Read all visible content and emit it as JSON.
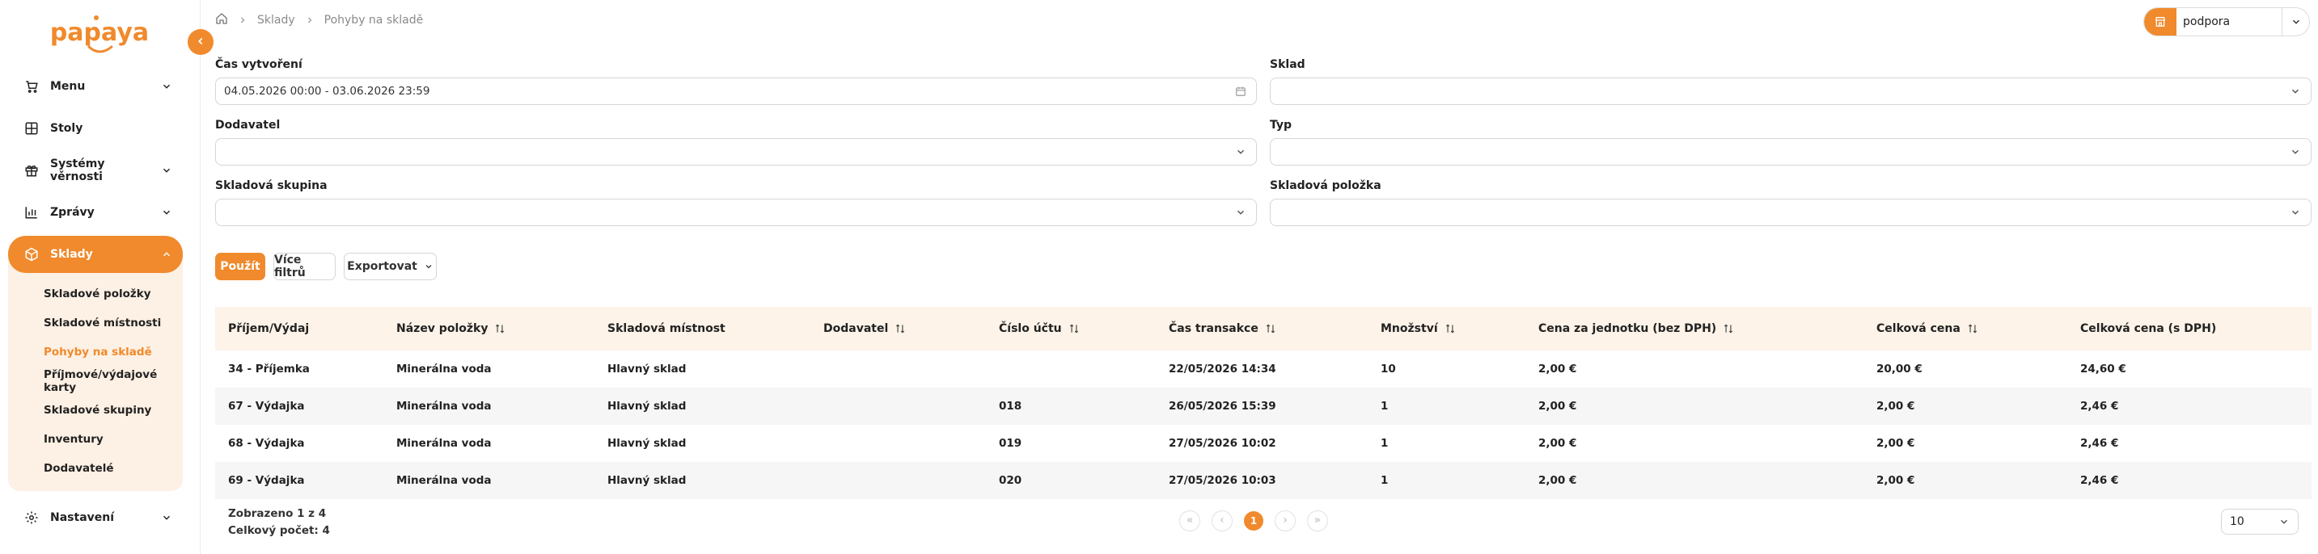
{
  "brand": {
    "logo_text": "papaya",
    "accent": "#f08a2c"
  },
  "sidebar": {
    "items": [
      {
        "label": "Menu",
        "icon": "cart-icon",
        "expandable": true
      },
      {
        "label": "Stoly",
        "icon": "table-grid-icon",
        "expandable": false
      },
      {
        "label": "Systémy věrnosti",
        "icon": "gift-icon",
        "expandable": true
      },
      {
        "label": "Zprávy",
        "icon": "bar-chart-icon",
        "expandable": true
      },
      {
        "label": "Sklady",
        "icon": "box-icon",
        "expandable": true,
        "active": true
      },
      {
        "label": "Nastavení",
        "icon": "gear-icon",
        "expandable": true
      }
    ],
    "sklady_sub": [
      {
        "label": "Skladové položky"
      },
      {
        "label": "Skladové místnosti"
      },
      {
        "label": "Pohyby na skladě",
        "active": true
      },
      {
        "label": "Příjmové/výdajové karty"
      },
      {
        "label": "Skladové skupiny"
      },
      {
        "label": "Inventury"
      },
      {
        "label": "Dodavatelé"
      }
    ]
  },
  "breadcrumb": {
    "home_icon": "home-icon",
    "items": [
      "Sklady",
      "Pohyby na skladě"
    ]
  },
  "account": {
    "name": "podpora",
    "icon": "store-icon"
  },
  "filters": {
    "created_label": "Čas vytvoření",
    "created_value": "04.05.2026 00:00 - 03.06.2026 23:59",
    "warehouse_label": "Sklad",
    "warehouse_value": "",
    "supplier_label": "Dodavatel",
    "supplier_value": "",
    "type_label": "Typ",
    "type_value": "",
    "group_label": "Skladová skupina",
    "group_value": "",
    "item_label": "Skladová položka",
    "item_value": ""
  },
  "actions": {
    "apply": "Použít",
    "more_filters": "Více filtrů",
    "export": "Exportovat"
  },
  "table": {
    "headers": [
      "Příjem/Výdaj",
      "Název položky",
      "Skladová místnost",
      "Dodavatel",
      "Číslo účtu",
      "Čas transakce",
      "Množství",
      "Cena za jednotku (bez DPH)",
      "Celková cena",
      "Celková cena (s DPH)"
    ],
    "sortable": [
      false,
      true,
      false,
      true,
      true,
      true,
      true,
      true,
      true,
      false
    ],
    "rows": [
      [
        "34 - Příjemka",
        "Minerálna voda",
        "Hlavný sklad",
        "",
        "",
        "22/05/2026 14:34",
        "10",
        "2,00 €",
        "20,00 €",
        "24,60 €"
      ],
      [
        "67 - Výdajka",
        "Minerálna voda",
        "Hlavný sklad",
        "",
        "018",
        "26/05/2026 15:39",
        "1",
        "2,00 €",
        "2,00 €",
        "2,46 €"
      ],
      [
        "68 - Výdajka",
        "Minerálna voda",
        "Hlavný sklad",
        "",
        "019",
        "27/05/2026 10:02",
        "1",
        "2,00 €",
        "2,00 €",
        "2,46 €"
      ],
      [
        "69 - Výdajka",
        "Minerálna voda",
        "Hlavný sklad",
        "",
        "020",
        "27/05/2026 10:03",
        "1",
        "2,00 €",
        "2,00 €",
        "2,46 €"
      ]
    ]
  },
  "footer": {
    "shown": "Zobrazeno 1 z 4",
    "total": "Celkový počet: 4",
    "current_page": "1",
    "page_size": "10"
  }
}
